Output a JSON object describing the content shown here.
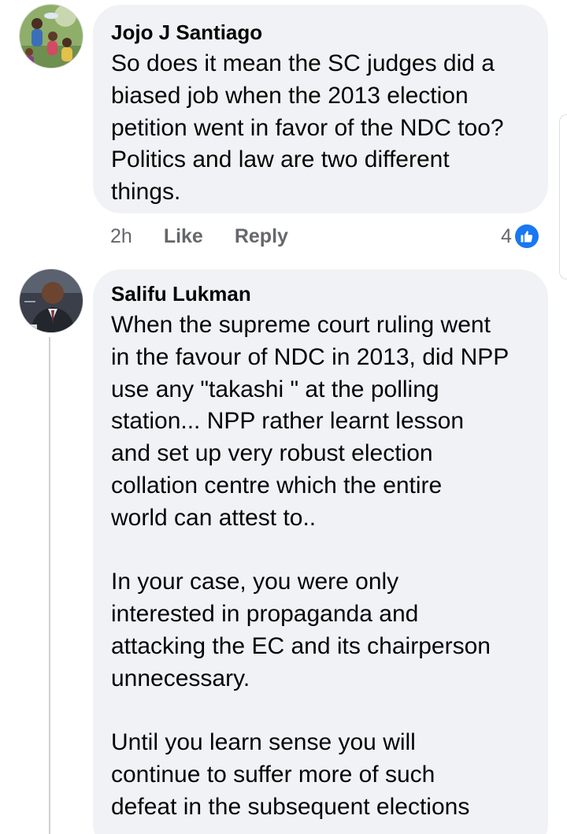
{
  "comments": [
    {
      "author": "Jojo J Santiago",
      "avatar_icon": "profile-avatar-icon",
      "text": "So does it mean the SC judges  did a\nbiased job when the 2013 election\npetition went in favor of the NDC too?\nPolitics and law are two different\nthings.",
      "time": "2h",
      "like_label": "Like",
      "reply_label": "Reply",
      "reaction_count": "4"
    },
    {
      "author": "Salifu Lukman",
      "avatar_icon": "profile-avatar-icon",
      "text": "When the supreme court ruling went\nin the favour of NDC in 2013, did NPP\nuse any \"takashi \" at the polling\nstation... NPP rather learnt lesson\nand set up very robust election\ncollation centre which the entire\nworld can attest to..\n\nIn your case, you were only\ninterested in propaganda and\nattacking the EC and its chairperson\nunnecessary.\n\nUntil you learn sense you will\ncontinue to suffer more of such\ndefeat in the subsequent elections"
    }
  ],
  "colors": {
    "bubble_bg": "#f0f2f5",
    "text": "#050505",
    "secondary_text": "#65676b",
    "like_blue": "#1877f2"
  }
}
